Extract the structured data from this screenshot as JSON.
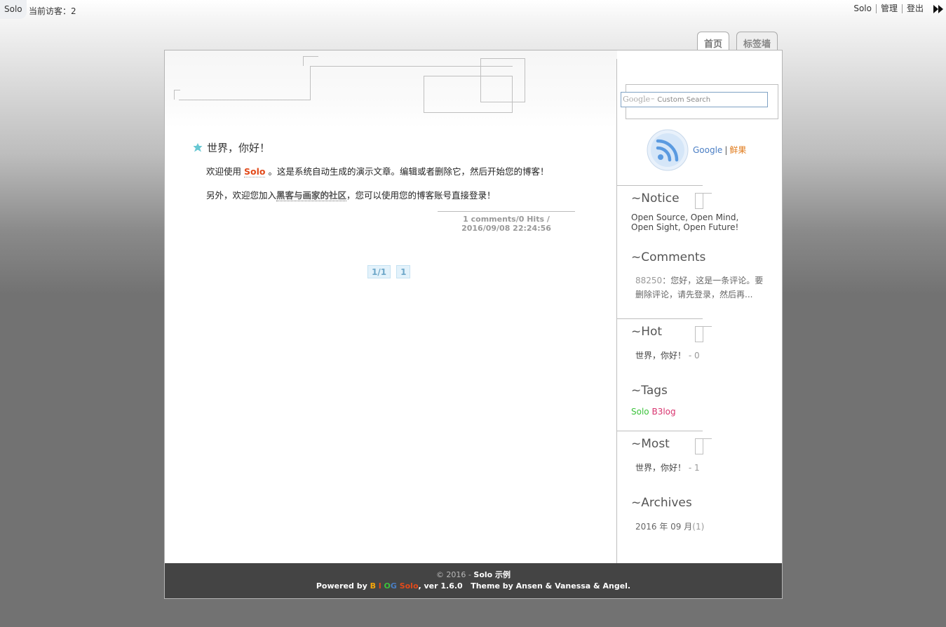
{
  "topbar": {
    "home_label": "Solo",
    "visitor_text": "当前访客：2",
    "links": [
      "Solo",
      "管理",
      "登出"
    ]
  },
  "tabs": {
    "home": "首页",
    "tags": "标签墙"
  },
  "article": {
    "title": "世界，你好！",
    "p1_before": "欢迎使用",
    "p1_highlight": "Solo",
    "p1_after": "。这是系统自动生成的演示文章。编辑或者删除它，然后开始您的博客！",
    "p2_before": "另外，欢迎您加入",
    "p2_link": "黑客与画家的社区",
    "p2_after": "，您可以使用您的博客账号直接登录！",
    "meta_line1": "1 comments/0 Hits /",
    "meta_line2": "2016/09/08 22:24:56"
  },
  "pager": {
    "current": "1/1",
    "page": "1"
  },
  "sidebar": {
    "search_brand": "Google",
    "search_tm": "™",
    "search_placeholder": "Custom Search",
    "feed_google": "Google",
    "feed_sep": "|",
    "feed_xianguo": "鲜果",
    "notice_title": "~Notice",
    "notice_text": "Open Source, Open Mind, Open Sight, Open Future!",
    "comments_title": "~Comments",
    "comment_name": "88250",
    "comment_text": "：您好，这是一条评论。要删除评论，请先登录，然后再...",
    "hot_title": "~Hot",
    "hot_item": "世界，你好！",
    "hot_count": "- 0",
    "tags_title": "~Tags",
    "tag1": "Solo",
    "tag2": "B3log",
    "most_title": "~Most",
    "most_item": "世界，你好！",
    "most_count": "- 1",
    "archives_title": "~Archives",
    "archive_item": "2016 年 09 月",
    "archive_count": "(1)"
  },
  "footer": {
    "copyright": "© 2016 -",
    "site_name": "Solo 示例",
    "powered_by": "Powered by",
    "brand_b": "B",
    "brand_l": "l",
    "brand_o": "O",
    "brand_g": "G",
    "solo": "Solo",
    "version": ", ver 1.6.0",
    "theme": "Theme by Ansen & Vanessa & Angel."
  },
  "colors": {
    "accent_orange": "#e24a1a",
    "link_blue": "#4a7ec4",
    "tag_green": "#3bc23b",
    "tag_pink": "#d8336e",
    "footer_bg": "#444444"
  },
  "icons": [
    "next-icon",
    "star-icon",
    "rss-icon"
  ]
}
